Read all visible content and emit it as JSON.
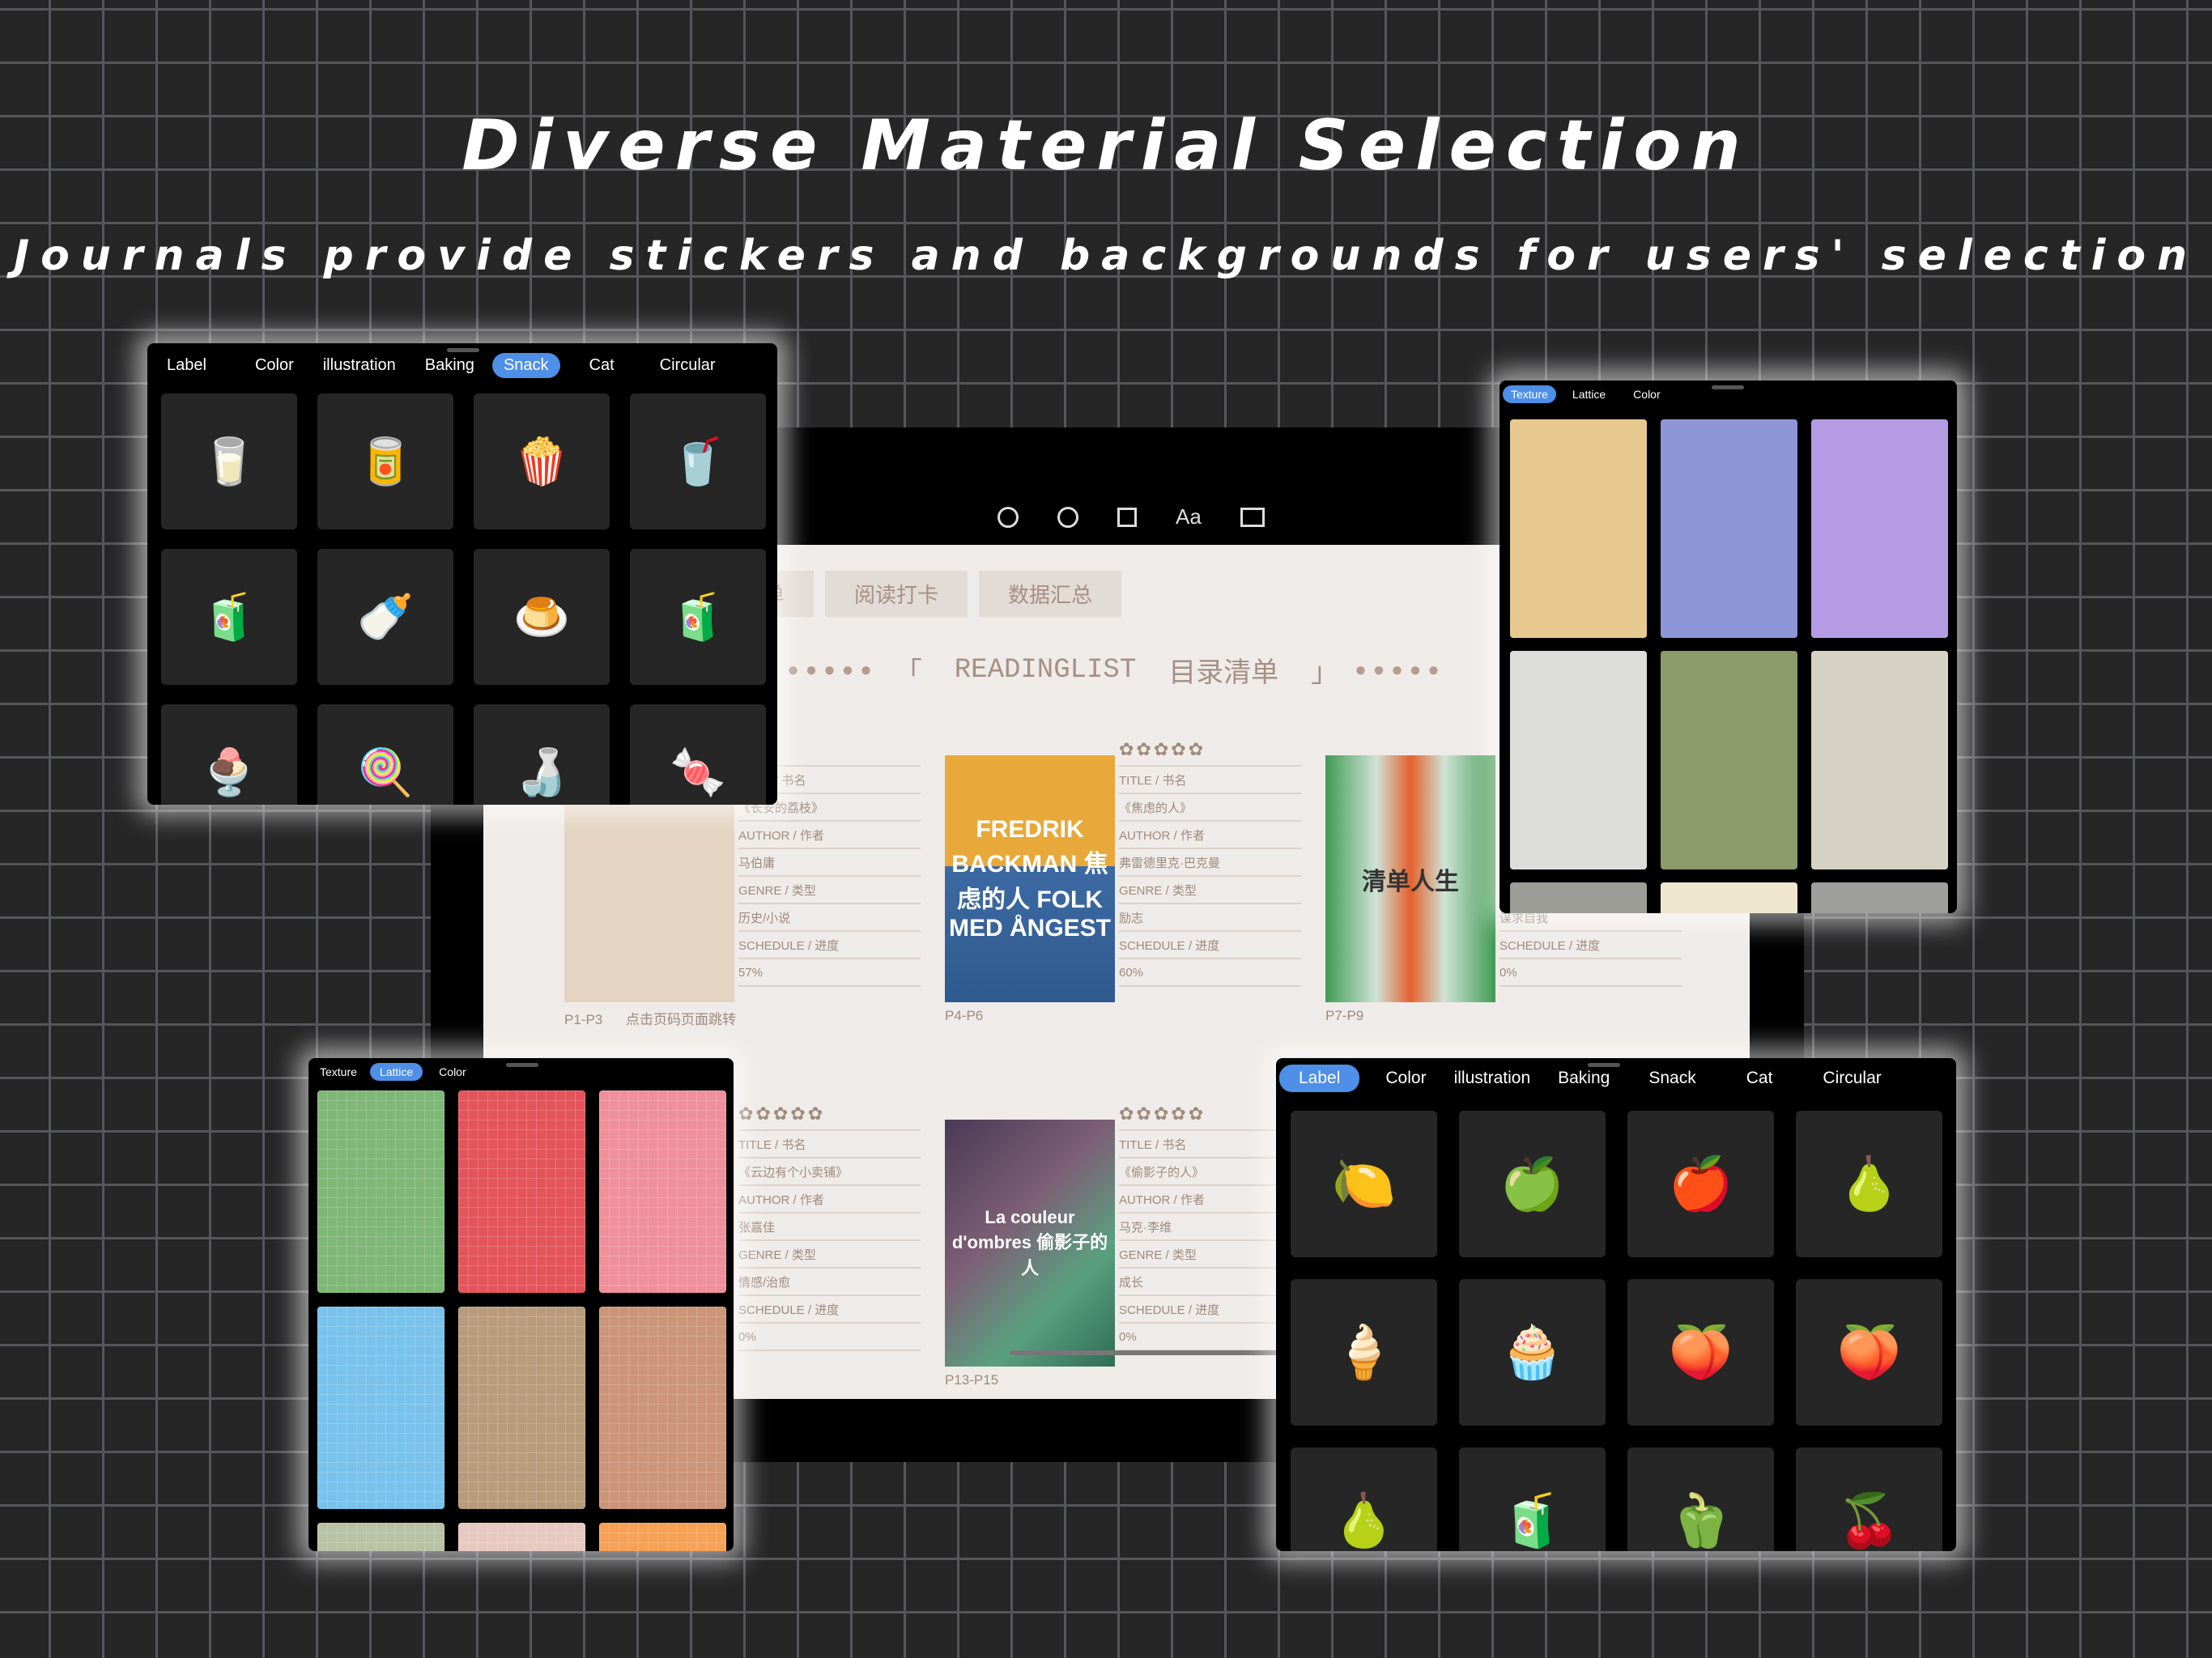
{
  "header": {
    "title": "Diverse Material Selection",
    "subtitle": "Journals provide stickers and backgrounds for users' selection"
  },
  "tablet": {
    "toolbar": [
      "Aa"
    ],
    "tabs": [
      "单",
      "阅读打卡",
      "数据汇总"
    ],
    "readinglist": {
      "label": "READINGLIST",
      "label_cn": "目录清单",
      "open_bracket": "「",
      "close_bracket": "」",
      "dots": "●●●●●"
    },
    "books": [
      {
        "cover": "",
        "stars": "",
        "title_label": "TITLE / 书名",
        "title": "《长安的荔枝》",
        "author_label": "AUTHOR / 作者",
        "author": "马伯庸",
        "genre_label": "GENRE / 类型",
        "genre": "历史/小说",
        "schedule_label": "SCHEDULE / 进度",
        "schedule": "57%",
        "pages": "P1-P3",
        "hint": "点击页码页面跳转"
      },
      {
        "cover": "FREDRIK BACKMAN 焦虑的人 FOLK MED ÅNGEST",
        "stars": "✿✿✿✿✿",
        "title_label": "TITLE / 书名",
        "title": "《焦虑的人》",
        "author_label": "AUTHOR / 作者",
        "author": "弗雷德里克·巴克曼",
        "genre_label": "GENRE / 类型",
        "genre": "励志",
        "schedule_label": "SCHEDULE / 进度",
        "schedule": "60%",
        "pages": "P4-P6",
        "hint": ""
      },
      {
        "cover": "清单人生",
        "stars": "",
        "title_label": "",
        "title": "",
        "author_label": "",
        "author": "",
        "genre_label": "",
        "genre": "谋求自我",
        "schedule_label": "SCHEDULE / 进度",
        "schedule": "0%",
        "pages": "P7-P9",
        "hint": ""
      },
      {
        "cover": "",
        "stars": "✿✿✿✿✿",
        "title_label": "TITLE / 书名",
        "title": "《云边有个小卖铺》",
        "author_label": "AUTHOR / 作者",
        "author": "张嘉佳",
        "genre_label": "GENRE / 类型",
        "genre": "情感/治愈",
        "schedule_label": "SCHEDULE / 进度",
        "schedule": "0%",
        "pages": "",
        "hint": ""
      },
      {
        "cover": "La couleur d'ombres 偷影子的人",
        "stars": "✿✿✿✿✿",
        "title_label": "TITLE / 书名",
        "title": "《偷影子的人》",
        "author_label": "AUTHOR / 作者",
        "author": "马克·李维",
        "genre_label": "GENRE / 类型",
        "genre": "成长",
        "schedule_label": "SCHEDULE / 进度",
        "schedule": "0%",
        "pages": "P13-P15",
        "hint": ""
      }
    ]
  },
  "panel_snack": {
    "tabs": [
      "Label",
      "Color",
      "illustration",
      "Baking",
      "Snack",
      "Cat",
      "Circular"
    ],
    "active": "Snack",
    "stickers": [
      "🥛",
      "🥫",
      "🍿",
      "🥤",
      "🧃",
      "🍼",
      "🍮",
      "🧃",
      "🍨",
      "🍭",
      "🍶",
      "🍬"
    ]
  },
  "panel_texture": {
    "tabs": [
      "Texture",
      "Lattice",
      "Color"
    ],
    "active": "Texture",
    "swatches": [
      "#e7c98f",
      "#8f96d8",
      "#b49be3",
      "#dddddb",
      "#8b9b6a",
      "#d6d2c3",
      "#9d9d97",
      "#efe6d0",
      "#9e9e9c"
    ]
  },
  "panel_lattice": {
    "tabs": [
      "Texture",
      "Lattice",
      "Color"
    ],
    "active": "Lattice",
    "swatches": [
      "#7fb776",
      "#e4545b",
      "#ef8f9c",
      "#78c2ec",
      "#b89b7b",
      "#cc9478",
      "#b9c2a4",
      "#e7c9c1",
      "#f7a155"
    ]
  },
  "panel_label": {
    "tabs": [
      "Label",
      "Color",
      "illustration",
      "Baking",
      "Snack",
      "Cat",
      "Circular"
    ],
    "active": "Label",
    "stickers": [
      "🍋",
      "🍏",
      "🍎",
      "🍐",
      "🍦",
      "🧁",
      "🍑",
      "🍑",
      "🍐",
      "🧃",
      "🫑",
      "🍒"
    ]
  }
}
